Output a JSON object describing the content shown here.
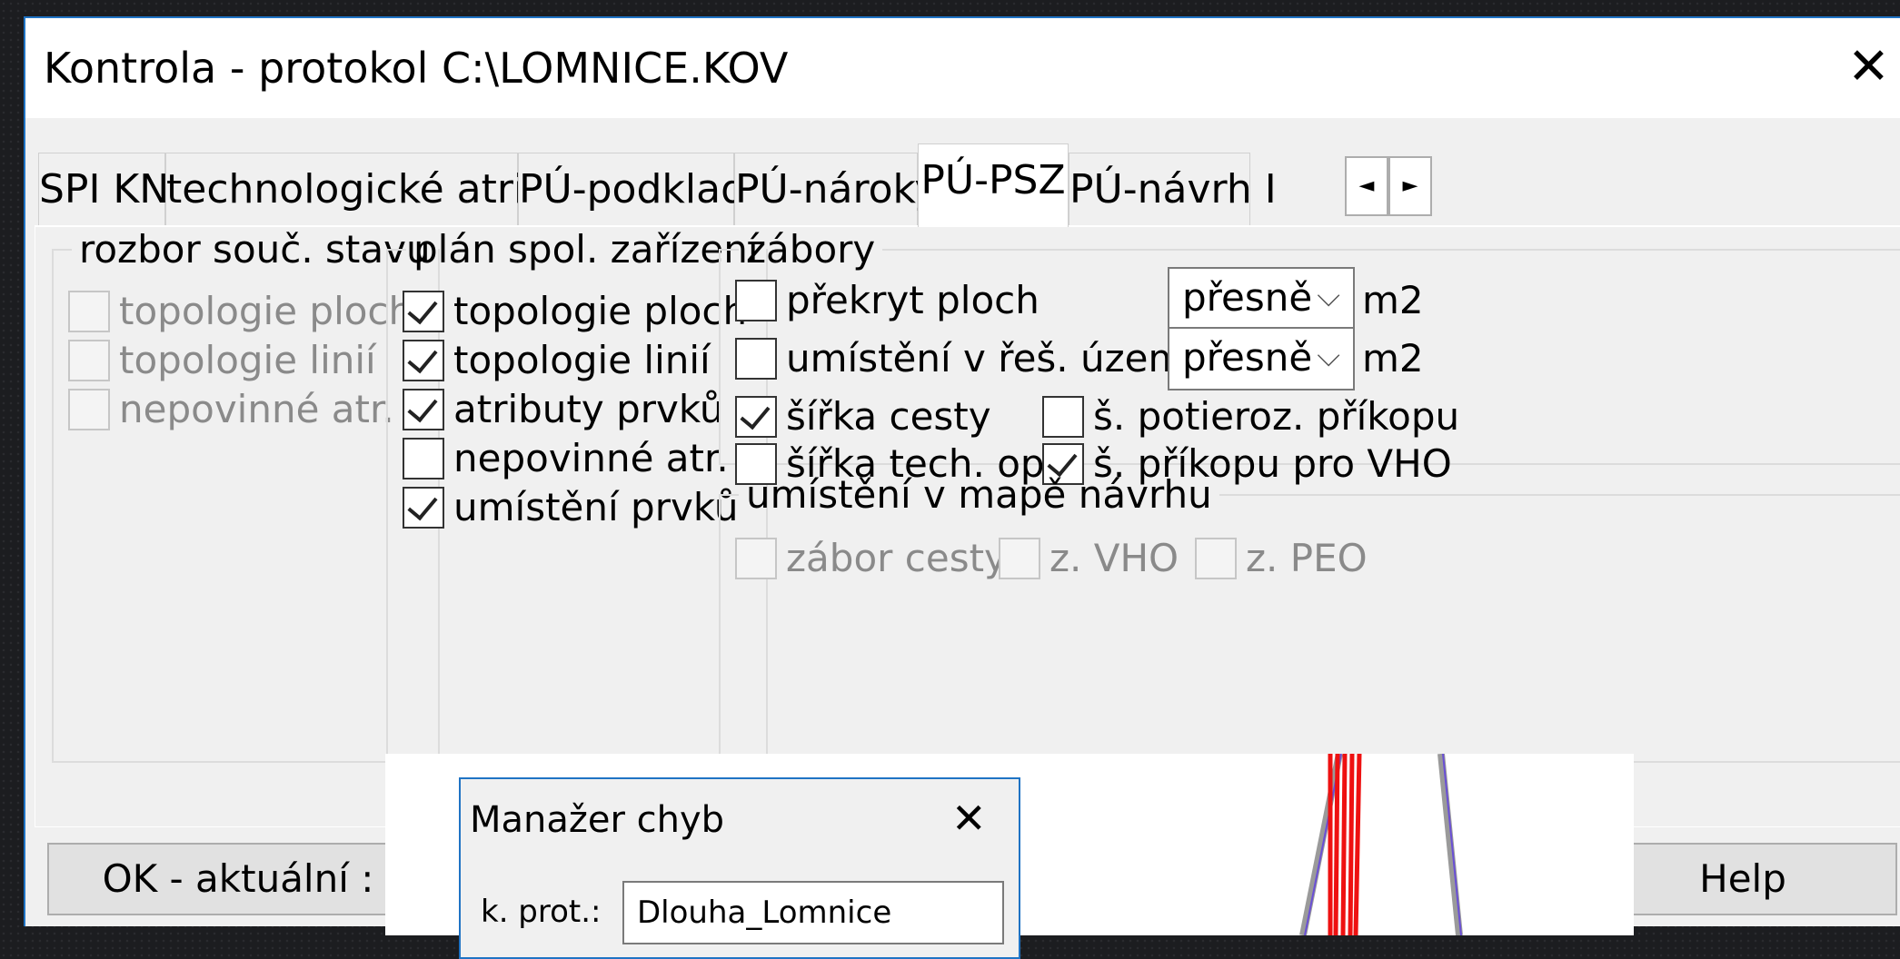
{
  "window": {
    "title": "Kontrola - protokol C:\\LOMNICE.KOV",
    "close_icon": "close-icon"
  },
  "tabs": [
    {
      "label": "SPI KN",
      "active": false
    },
    {
      "label": "technologické atributy",
      "active": false
    },
    {
      "label": "PÚ-podklady",
      "active": false
    },
    {
      "label": "PÚ-nároky",
      "active": false
    },
    {
      "label": "PÚ-PSZ",
      "active": true
    },
    {
      "label": "PÚ-návrh I",
      "active": false
    }
  ],
  "tab_scroll": {
    "left": "◄",
    "right": "►"
  },
  "groups": {
    "rozbor": {
      "legend": "rozbor souč. stavu",
      "items": [
        {
          "label": "topologie ploch",
          "checked": false,
          "disabled": true
        },
        {
          "label": "topologie linií",
          "checked": false,
          "disabled": true
        },
        {
          "label": "nepovinné atr.",
          "checked": false,
          "disabled": true
        }
      ]
    },
    "plan": {
      "legend": "plán spol. zařízení",
      "items": [
        {
          "label": "topologie ploch",
          "checked": true
        },
        {
          "label": "topologie linií",
          "checked": true
        },
        {
          "label": "atributy prvků",
          "checked": true
        },
        {
          "label": "nepovinné atr.",
          "checked": false
        },
        {
          "label": "umístění prvků",
          "checked": true
        }
      ]
    },
    "zabory": {
      "legend": "zábory",
      "prekryt": {
        "label": "překryt ploch",
        "checked": false
      },
      "umisteni": {
        "label": "umístění v řeš. území",
        "checked": false
      },
      "select1": {
        "value": "přesně",
        "unit": "m2"
      },
      "select2": {
        "value": "přesně",
        "unit": "m2"
      },
      "sirka_cesty": {
        "label": "šířka cesty",
        "checked": true
      },
      "sirka_tech": {
        "label": "šířka tech. op.",
        "checked": false
      },
      "s_potieroz": {
        "label": "š. potieroz. příkopu",
        "checked": false
      },
      "s_prikopu": {
        "label": "š. příkopu pro VHO",
        "checked": true
      }
    },
    "mapa": {
      "legend": "umístění v mapě návrhu",
      "items": [
        {
          "label": "zábor cesty",
          "checked": false,
          "disabled": true
        },
        {
          "label": "z. VHO",
          "checked": false,
          "disabled": true
        },
        {
          "label": "z. PEO",
          "checked": false,
          "disabled": true
        }
      ]
    }
  },
  "buttons": {
    "ok": "OK - aktuální :",
    "help": "Help"
  },
  "error_manager": {
    "title": "Manažer chyb",
    "label": "k. prot.:",
    "value": "Dlouha_Lomnice"
  }
}
